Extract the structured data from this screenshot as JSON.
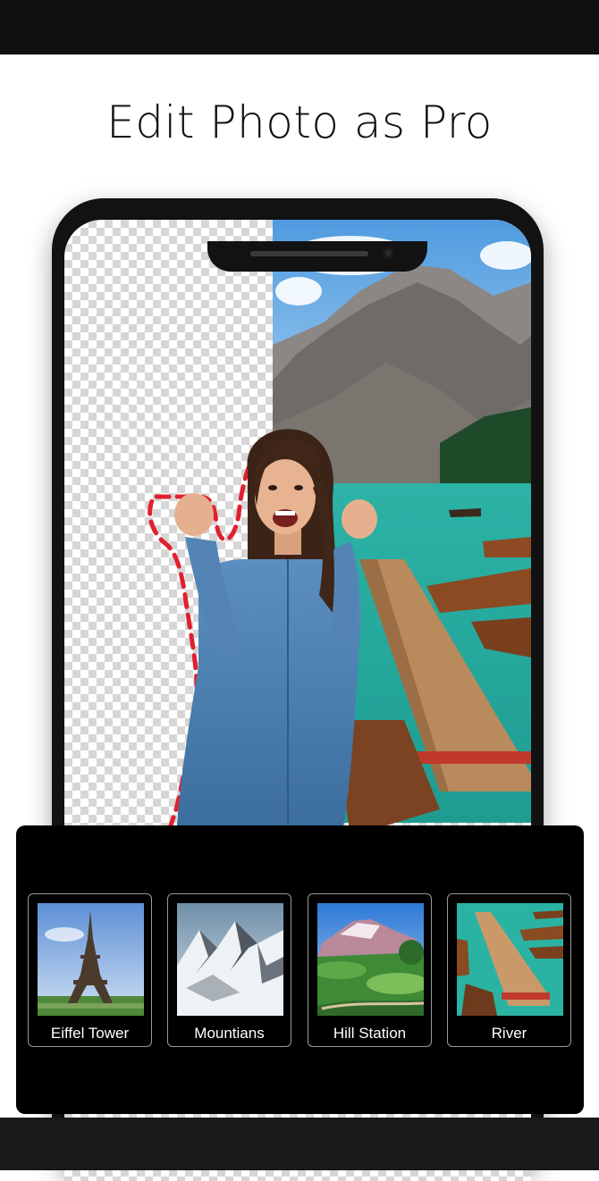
{
  "header": {
    "title": "Edit Photo as Pro"
  },
  "categories": [
    {
      "label": "Eiffel Tower",
      "icon": "eiffel-tower-thumbnail"
    },
    {
      "label": "Mountians",
      "icon": "snow-mountains-thumbnail"
    },
    {
      "label": "Hill Station",
      "icon": "hill-station-thumbnail"
    },
    {
      "label": "River",
      "icon": "river-pier-thumbnail"
    }
  ],
  "colors": {
    "selection_outline": "#e02030",
    "panel_background": "#000000",
    "lake": "#2fb7a8"
  }
}
